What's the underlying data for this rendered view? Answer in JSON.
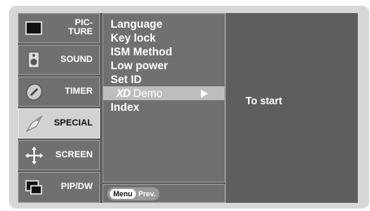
{
  "nav": {
    "items": [
      {
        "label": "PIC-\nTURE",
        "icon": "picture-icon"
      },
      {
        "label": "SOUND",
        "icon": "speaker-icon"
      },
      {
        "label": "TIMER",
        "icon": "clock-icon"
      },
      {
        "label": "SPECIAL",
        "icon": "special-icon",
        "active": true
      },
      {
        "label": "SCREEN",
        "icon": "screen-move-icon"
      },
      {
        "label": "PIP/DW",
        "icon": "pip-icon"
      }
    ]
  },
  "submenu": {
    "items": [
      {
        "label": "Language"
      },
      {
        "label": "Key lock"
      },
      {
        "label": "ISM Method"
      },
      {
        "label": "Low power"
      },
      {
        "label": "Set ID"
      },
      {
        "label_logo": "XD",
        "label": "Demo",
        "highlighted": true,
        "has_arrow": true
      },
      {
        "label": "Index"
      }
    ]
  },
  "detail": {
    "text": "To start"
  },
  "bottom_bar": {
    "menu_label": "Menu",
    "prev_label": "Prev."
  },
  "colors": {
    "panel": "#d7d7d7",
    "screen": "#5e5e5e",
    "tile": "#707070",
    "active_tile": "#d2d2d2",
    "highlight": "#bdbdbd"
  }
}
